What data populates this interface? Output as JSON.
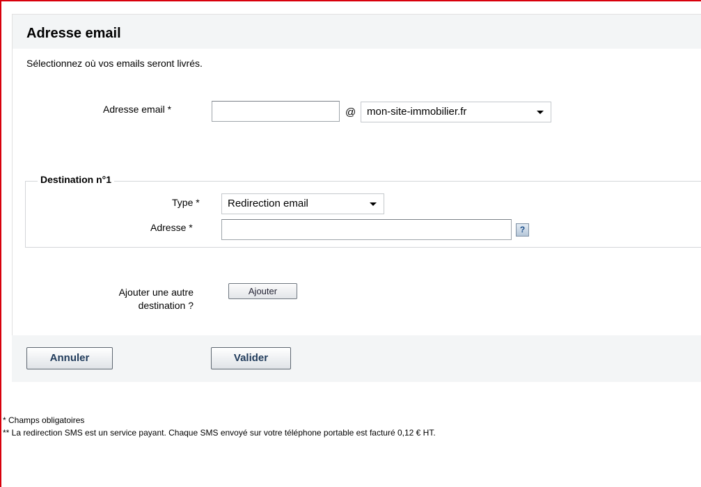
{
  "header": {
    "title": "Adresse email"
  },
  "intro": "Sélectionnez où vos emails seront livrés.",
  "email_section": {
    "label": "Adresse email *",
    "local_value": "",
    "at": "@",
    "domain_selected": "mon-site-immobilier.fr"
  },
  "destination": {
    "legend": "Destination n°1",
    "type_label": "Type *",
    "type_selected": "Redirection email",
    "address_label": "Adresse *",
    "address_value": "",
    "help_glyph": "?"
  },
  "add_destination": {
    "label_line1": "Ajouter une autre",
    "label_line2": "destination ?",
    "button_label": "Ajouter"
  },
  "actions": {
    "cancel_label": "Annuler",
    "submit_label": "Valider"
  },
  "notes": {
    "required": "* Champs obligatoires",
    "sms": "** La redirection SMS est un service payant. Chaque SMS envoyé sur votre téléphone portable est facturé 0,12 € HT."
  },
  "colors": {
    "frame": "#d8000c",
    "header_bg": "#f3f5f6"
  }
}
